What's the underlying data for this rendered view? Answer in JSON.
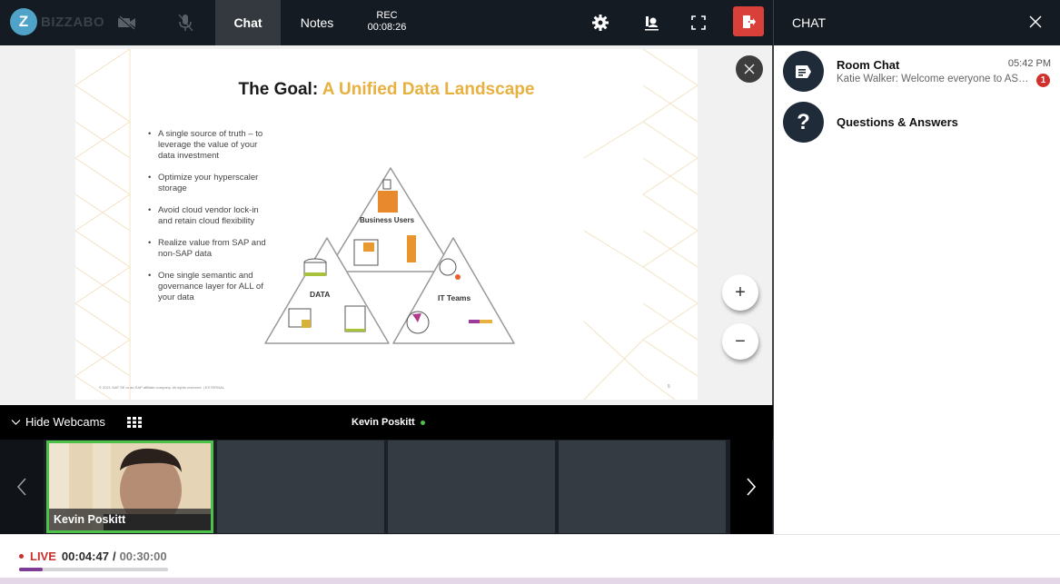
{
  "app": {
    "brand": "BIZZABO",
    "logo_letter": "Z"
  },
  "topbar": {
    "tabs": [
      {
        "label": "Chat",
        "active": true
      },
      {
        "label": "Notes",
        "active": false
      }
    ],
    "rec_label": "REC",
    "rec_time": "00:08:26",
    "icons": [
      "camera-off-icon",
      "mic-off-icon",
      "settings-icon",
      "presenter-icon",
      "fullscreen-icon",
      "exit-icon"
    ]
  },
  "chat": {
    "title": "CHAT",
    "items": [
      {
        "name": "Room Chat",
        "time": "05:42 PM",
        "preview": "Katie Walker: Welcome everyone to AS…",
        "unread": "1",
        "icon": "chat-bubble-icon"
      },
      {
        "name": "Questions & Answers",
        "icon": "question-icon"
      }
    ]
  },
  "slide": {
    "title_main": "The Goal: ",
    "title_accent": "A Unified Data Landscape",
    "bullets": [
      "A single source of truth – to leverage the value of your data investment",
      "Optimize your hyperscaler storage",
      "Avoid cloud vendor lock-in and retain cloud flexibility",
      "Realize value from SAP and non-SAP data",
      "One single semantic and governance layer for ALL of your data"
    ],
    "diagram_labels": {
      "top": "Business Users",
      "left": "DATA",
      "right": "IT Teams"
    },
    "footer": "© 2021 SAP SE or an SAP affiliate company. All rights reserved. | EXTERNAL",
    "page_number": "5",
    "accent_color": "#e8b13f"
  },
  "webcams": {
    "toggle_label": "Hide Webcams",
    "active_speaker": "Kevin Poskitt",
    "tiles": [
      {
        "name": "Kevin Poskitt",
        "active": true
      },
      {
        "name": "",
        "active": false
      },
      {
        "name": "",
        "active": false
      },
      {
        "name": "",
        "active": false
      }
    ]
  },
  "playback": {
    "live_label": "LIVE",
    "elapsed": "00:04:47",
    "separator": "/",
    "duration": "00:30:00",
    "progress_fraction": 0.16
  },
  "colors": {
    "live_red": "#c9302c",
    "progress_purple": "#7d3b93",
    "speaker_green": "#4cc24a",
    "exit_red": "#d9403a"
  }
}
